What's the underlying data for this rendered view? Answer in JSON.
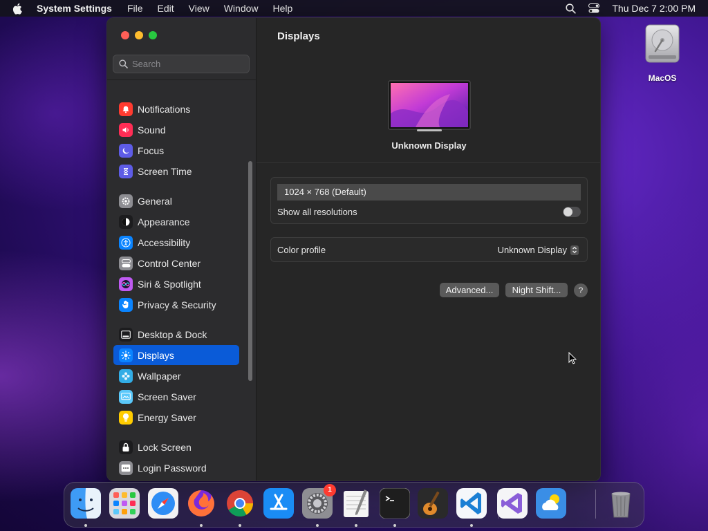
{
  "menubar": {
    "app_name": "System Settings",
    "menus": [
      "File",
      "Edit",
      "View",
      "Window",
      "Help"
    ],
    "clock": "Thu Dec 7  2:00 PM"
  },
  "desktop": {
    "icon_label": "MacOS"
  },
  "window": {
    "search_placeholder": "Search",
    "sidebar": [
      {
        "label": "Notifications",
        "icon": "bell-icon",
        "color": "#ff3b30"
      },
      {
        "label": "Sound",
        "icon": "speaker-icon",
        "color": "#ff2d55"
      },
      {
        "label": "Focus",
        "icon": "moon-icon",
        "color": "#5e5ce6"
      },
      {
        "label": "Screen Time",
        "icon": "hourglass-icon",
        "color": "#5e5ce6"
      },
      {
        "label": "General",
        "icon": "gear-icon",
        "color": "#8e8e93"
      },
      {
        "label": "Appearance",
        "icon": "appearance-icon",
        "color": "#1c1c1e"
      },
      {
        "label": "Accessibility",
        "icon": "accessibility-icon",
        "color": "#0a84ff"
      },
      {
        "label": "Control Center",
        "icon": "control-center-icon",
        "color": "#8e8e93"
      },
      {
        "label": "Siri & Spotlight",
        "icon": "siri-icon",
        "color": "#bf5af2"
      },
      {
        "label": "Privacy & Security",
        "icon": "hand-icon",
        "color": "#0a84ff"
      },
      {
        "label": "Desktop & Dock",
        "icon": "dock-icon",
        "color": "#1c1c1e"
      },
      {
        "label": "Displays",
        "icon": "sun-icon",
        "color": "#0a84ff",
        "selected": true
      },
      {
        "label": "Wallpaper",
        "icon": "flower-icon",
        "color": "#32ade6"
      },
      {
        "label": "Screen Saver",
        "icon": "screen-saver-icon",
        "color": "#5ac8fa"
      },
      {
        "label": "Energy Saver",
        "icon": "bulb-icon",
        "color": "#ffcc00"
      },
      {
        "label": "Lock Screen",
        "icon": "lock-icon",
        "color": "#1c1c1e"
      },
      {
        "label": "Login Password",
        "icon": "login-password-icon",
        "color": "#8e8e93"
      }
    ],
    "content": {
      "title": "Displays",
      "display_name": "Unknown Display",
      "resolution": "1024 × 768 (Default)",
      "show_all_label": "Show all resolutions",
      "show_all_enabled": false,
      "color_profile_label": "Color profile",
      "color_profile_value": "Unknown Display",
      "advanced_label": "Advanced...",
      "night_shift_label": "Night Shift...",
      "help_label": "?"
    }
  },
  "dock": {
    "apps": [
      {
        "name": "finder-icon"
      },
      {
        "name": "launchpad-icon"
      },
      {
        "name": "safari-icon"
      },
      {
        "name": "firefox-icon"
      },
      {
        "name": "chrome-icon"
      },
      {
        "name": "app-store-icon"
      },
      {
        "name": "system-settings-icon",
        "badge": "1"
      },
      {
        "name": "textedit-icon"
      },
      {
        "name": "terminal-icon"
      },
      {
        "name": "garageband-icon"
      },
      {
        "name": "vscode-icon"
      },
      {
        "name": "visual-studio-icon"
      },
      {
        "name": "weather-icon"
      },
      {
        "name": "trash-icon"
      }
    ]
  }
}
